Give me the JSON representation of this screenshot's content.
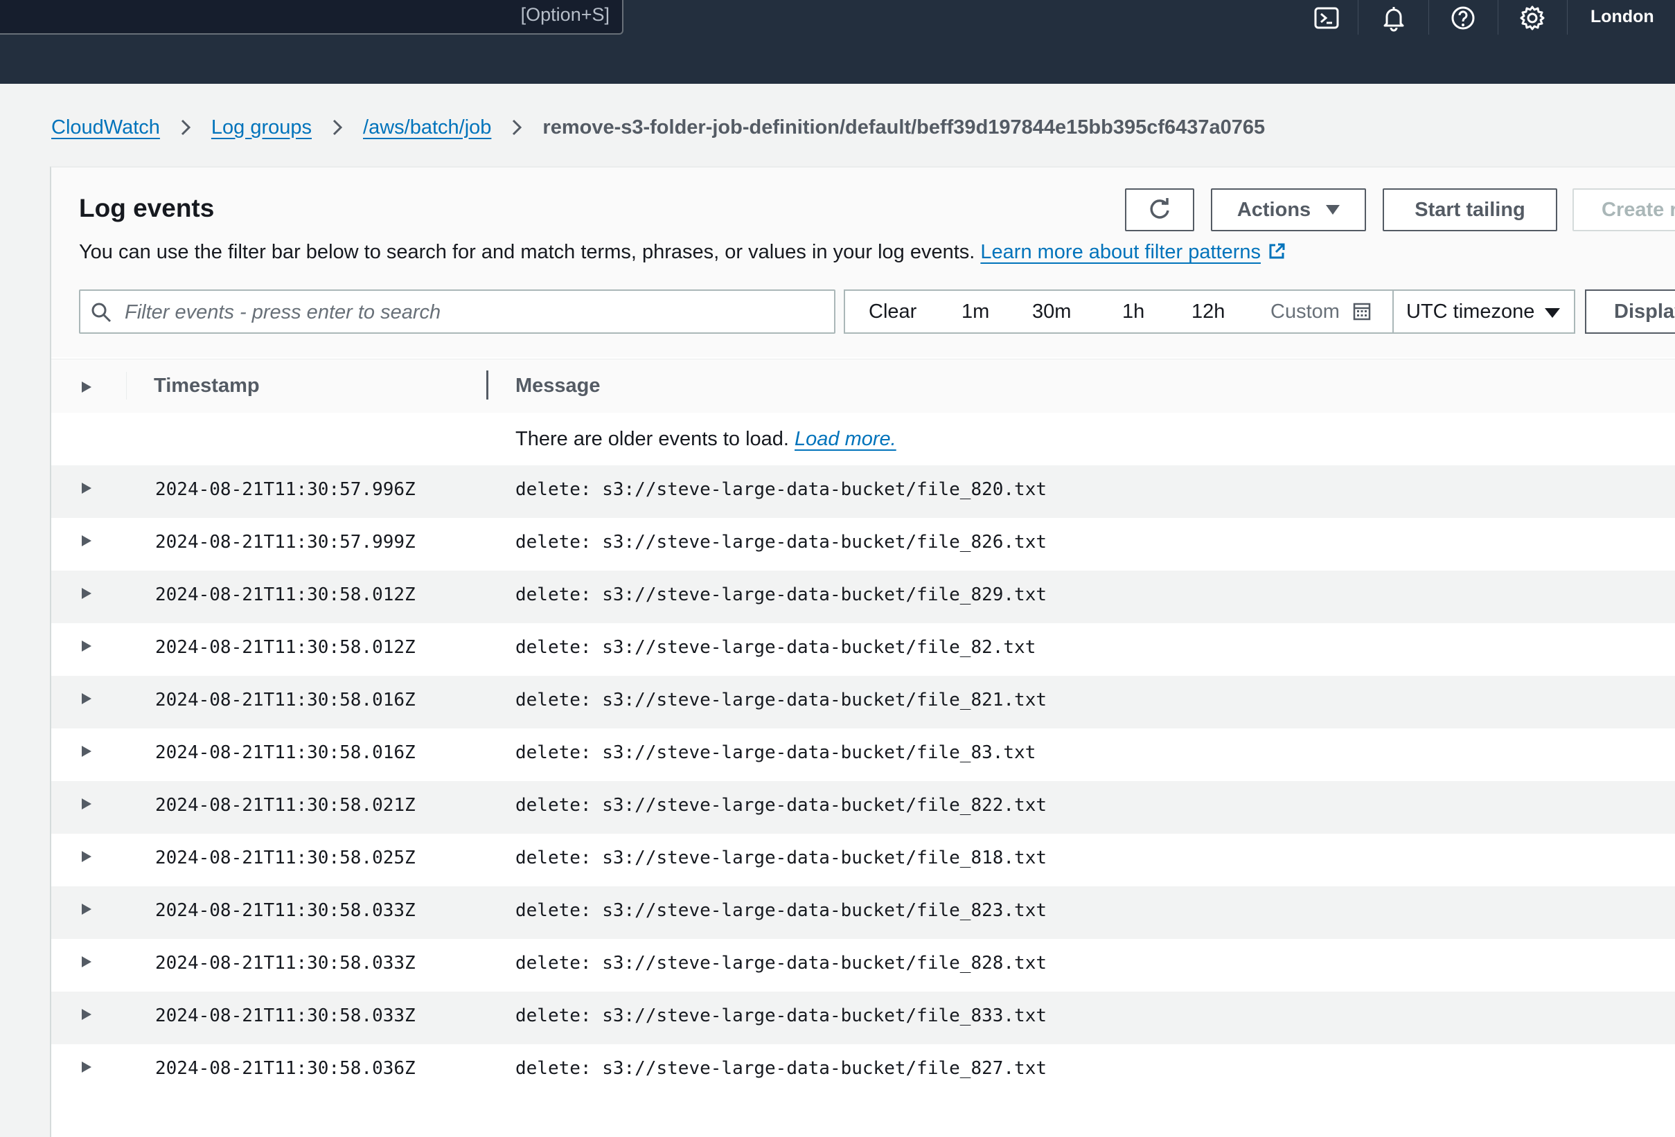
{
  "topbar": {
    "search_shortcut": "[Option+S]",
    "region": "London",
    "icons": [
      "cloudshell-icon",
      "bell-icon",
      "help-icon",
      "gear-icon"
    ]
  },
  "breadcrumb": {
    "items": [
      "CloudWatch",
      "Log groups",
      "/aws/batch/job"
    ],
    "current": "remove-s3-folder-job-definition/default/beff39d197844e15bb395cf6437a0765"
  },
  "panel": {
    "title": "Log events",
    "description": "You can use the filter bar below to search for and match terms, phrases, or values in your log events.",
    "learn_more": "Learn more about filter patterns",
    "actions_label": "Actions",
    "tail_label": "Start tailing",
    "create_label": "Create r"
  },
  "filter": {
    "placeholder": "Filter events - press enter to search",
    "value": "",
    "ranges": {
      "clear": "Clear",
      "r1m": "1m",
      "r30m": "30m",
      "r1h": "1h",
      "r12h": "12h",
      "custom": "Custom"
    },
    "timezone": "UTC timezone",
    "display_label": "Display"
  },
  "table": {
    "col_timestamp": "Timestamp",
    "col_message": "Message",
    "older_notice": "There are older events to load.",
    "load_more": "Load more.",
    "rows": [
      {
        "ts": "2024-08-21T11:30:57.996Z",
        "msg": "delete: s3://steve-large-data-bucket/file_820.txt"
      },
      {
        "ts": "2024-08-21T11:30:57.999Z",
        "msg": "delete: s3://steve-large-data-bucket/file_826.txt"
      },
      {
        "ts": "2024-08-21T11:30:58.012Z",
        "msg": "delete: s3://steve-large-data-bucket/file_829.txt"
      },
      {
        "ts": "2024-08-21T11:30:58.012Z",
        "msg": "delete: s3://steve-large-data-bucket/file_82.txt"
      },
      {
        "ts": "2024-08-21T11:30:58.016Z",
        "msg": "delete: s3://steve-large-data-bucket/file_821.txt"
      },
      {
        "ts": "2024-08-21T11:30:58.016Z",
        "msg": "delete: s3://steve-large-data-bucket/file_83.txt"
      },
      {
        "ts": "2024-08-21T11:30:58.021Z",
        "msg": "delete: s3://steve-large-data-bucket/file_822.txt"
      },
      {
        "ts": "2024-08-21T11:30:58.025Z",
        "msg": "delete: s3://steve-large-data-bucket/file_818.txt"
      },
      {
        "ts": "2024-08-21T11:30:58.033Z",
        "msg": "delete: s3://steve-large-data-bucket/file_823.txt"
      },
      {
        "ts": "2024-08-21T11:30:58.033Z",
        "msg": "delete: s3://steve-large-data-bucket/file_828.txt"
      },
      {
        "ts": "2024-08-21T11:30:58.033Z",
        "msg": "delete: s3://steve-large-data-bucket/file_833.txt"
      },
      {
        "ts": "2024-08-21T11:30:58.036Z",
        "msg": "delete: s3://steve-large-data-bucket/file_827.txt"
      }
    ]
  }
}
